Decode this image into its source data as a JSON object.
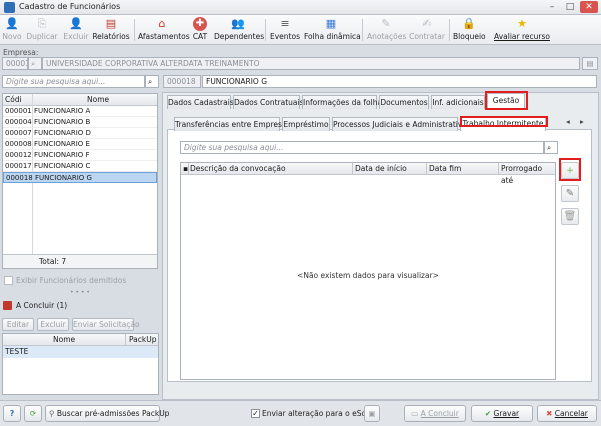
{
  "window": {
    "title": "Cadastro de Funcionários"
  },
  "toolbar": {
    "novo": "Novo",
    "duplicar": "Duplicar",
    "excluir": "Excluir",
    "relatorios": "Relatórios",
    "afastamentos": "Afastamentos",
    "cat": "CAT",
    "dependentes": "Dependentes",
    "eventos": "Eventos",
    "folha_dinamica": "Folha dinâmica",
    "anotacoes": "Anotações",
    "contratar": "Contratar",
    "bloqueio": "Bloqueio",
    "avaliar_recurso": "Avaliar recurso"
  },
  "company": {
    "label": "Empresa:",
    "code": "00001",
    "name": "UNIVERSIDADE CORPORATIVA ALTERDATA TREINAMENTO"
  },
  "search": {
    "placeholder": "Digite sua pesquisa aqui..."
  },
  "employee_header": {
    "code": "000018",
    "name": "FUNCIONARIO G"
  },
  "employee_list": {
    "col_code": "Códi",
    "col_name": "Nome",
    "rows": [
      {
        "code": "000001",
        "name": "FUNCIONARIO A"
      },
      {
        "code": "000004",
        "name": "FUNCIONARIO B"
      },
      {
        "code": "000007",
        "name": "FUNCIONARIO D"
      },
      {
        "code": "000008",
        "name": "FUNCIONARIO E"
      },
      {
        "code": "000012",
        "name": "FUNCIONARIO F"
      },
      {
        "code": "000017",
        "name": "FUNCIONARIO C"
      },
      {
        "code": "000018",
        "name": "FUNCIONARIO G"
      }
    ],
    "total": "Total: 7"
  },
  "left_options": {
    "show_dismissed": "Exibir Funcionários demitidos",
    "pending_title": "A Concluir (1)",
    "editar": "Editar",
    "excluir": "Excluir",
    "enviar": "Enviar Solicitação",
    "col_nome": "Nome",
    "col_packup": "PackUp",
    "pending_rows": [
      "TESTE"
    ]
  },
  "tabs": [
    "Dados Cadastrais",
    "Dados Contratuais",
    "Informações da folha",
    "Documentos",
    "Inf. adicionais",
    "Gestão"
  ],
  "subtabs": [
    "Transferências entre Empresas",
    "Empréstimo",
    "Processos Judiciais e Administrativos",
    "Trabalho Intermitente"
  ],
  "grid": {
    "search_placeholder": "Digite sua pesquisa aqui...",
    "columns": [
      "Descrição da convocação",
      "Data de início",
      "Data fim",
      "Prorrogado até"
    ],
    "empty_message": "<Não existem dados para visualizar>"
  },
  "bottom": {
    "buscar": "Buscar pré-admissões PackUp",
    "enviar_esocial": "Enviar alteração para o eSocial",
    "concluir": "A Concluir",
    "gravar": "Gravar",
    "cancelar": "Cancelar"
  },
  "colors": {
    "selection": "#bcd6f2",
    "highlight": "#e21d1d",
    "accent": "#2e6fb5"
  }
}
